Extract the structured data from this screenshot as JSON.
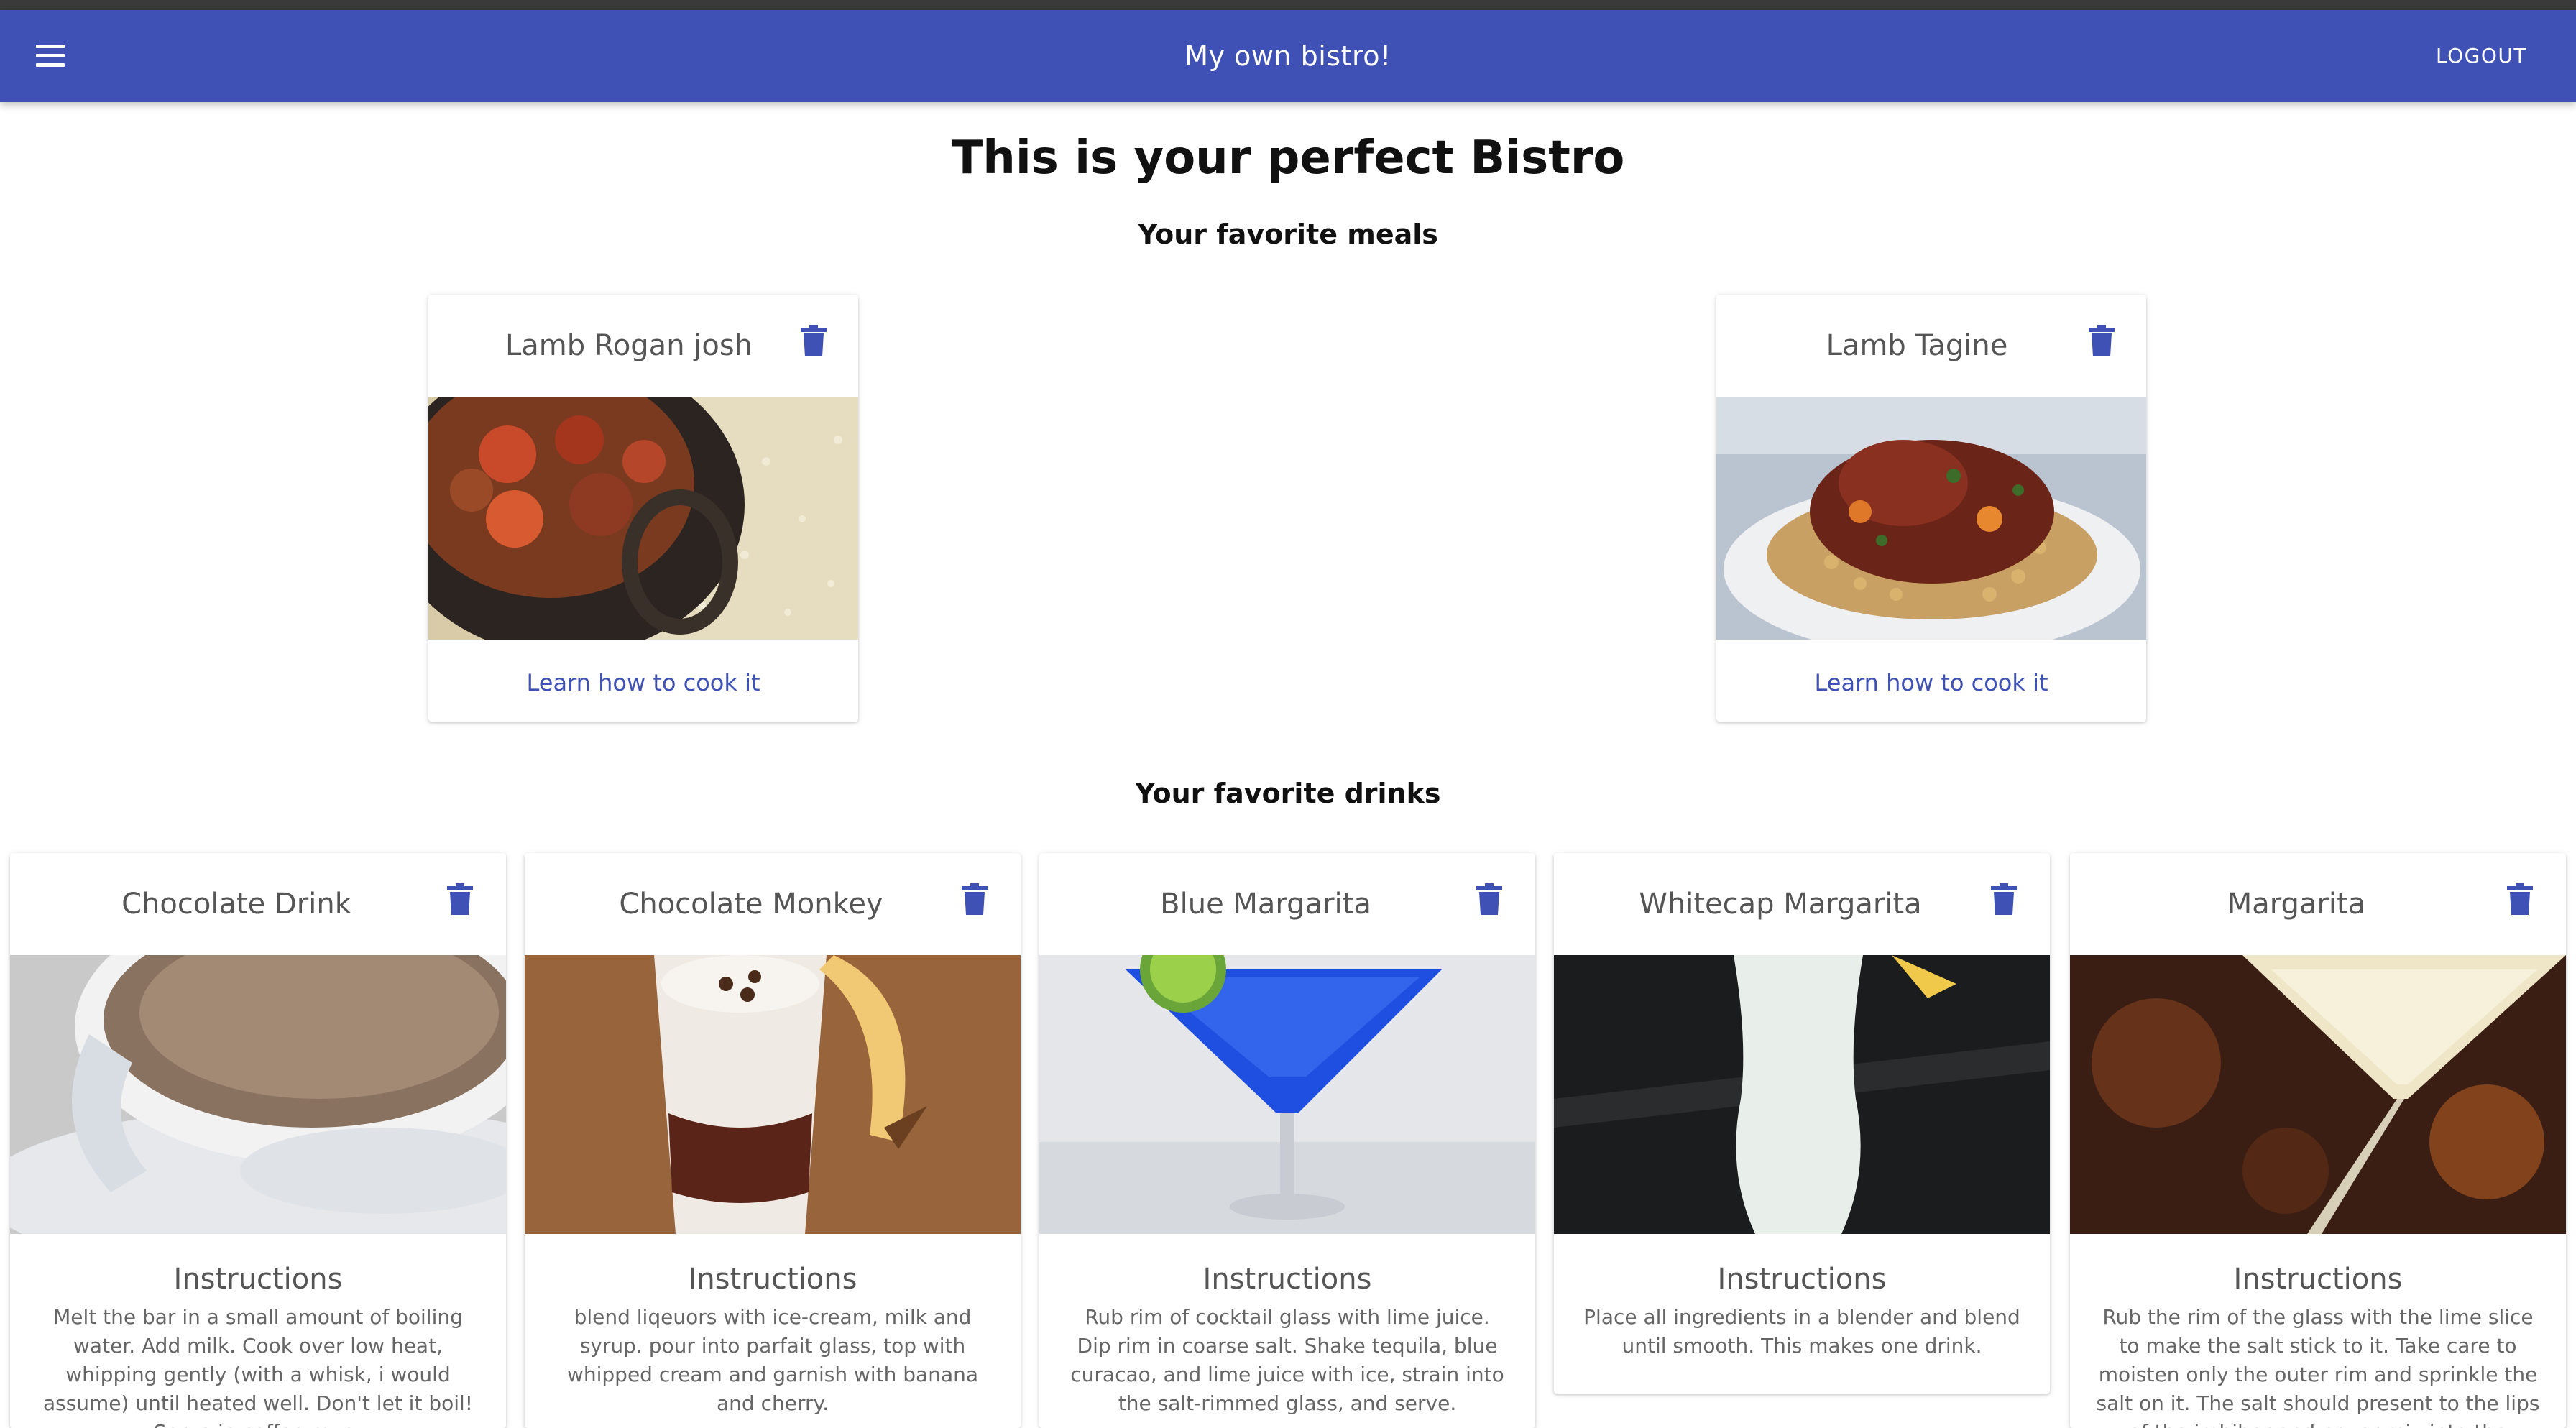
{
  "appbar": {
    "title": "My own bistro!",
    "menu_icon": "hamburger-menu-icon",
    "logout_label": "LOGOUT"
  },
  "page": {
    "heading": "This is your perfect Bistro"
  },
  "meals": {
    "heading": "Your favorite meals",
    "items": [
      {
        "title": "Lamb Rogan josh",
        "link": "Learn how to cook it"
      },
      {
        "title": "Lamb Tagine",
        "link": "Learn how to cook it"
      }
    ]
  },
  "drinks": {
    "heading": "Your favorite drinks",
    "items": [
      {
        "title": "Chocolate Drink",
        "instructions_label": "Instructions",
        "instructions": "Melt the bar in a small amount of boiling water. Add milk. Cook over low heat, whipping gently (with a whisk, i would assume) until heated well. Don't let it boil! Serve in coffee mug."
      },
      {
        "title": "Chocolate Monkey",
        "instructions_label": "Instructions",
        "instructions": "blend liqeuors with ice-cream, milk and syrup. pour into parfait glass, top with whipped cream and garnish with banana and cherry."
      },
      {
        "title": "Blue Margarita",
        "instructions_label": "Instructions",
        "instructions": "Rub rim of cocktail glass with lime juice. Dip rim in coarse salt. Shake tequila, blue curacao, and lime juice with ice, strain into the salt-rimmed glass, and serve."
      },
      {
        "title": "Whitecap Margarita",
        "instructions_label": "Instructions",
        "instructions": "Place all ingredients in a blender and blend until smooth. This makes one drink."
      },
      {
        "title": "Margarita",
        "instructions_label": "Instructions",
        "instructions": "Rub the rim of the glass with the lime slice to make the salt stick to it. Take care to moisten only the outer rim and sprinkle the salt on it. The salt should present to the lips of the imbiber and never mix into the cocktail."
      }
    ]
  },
  "colors": {
    "primary": "#3f51b5",
    "topstrip": "#3a3a3a"
  }
}
